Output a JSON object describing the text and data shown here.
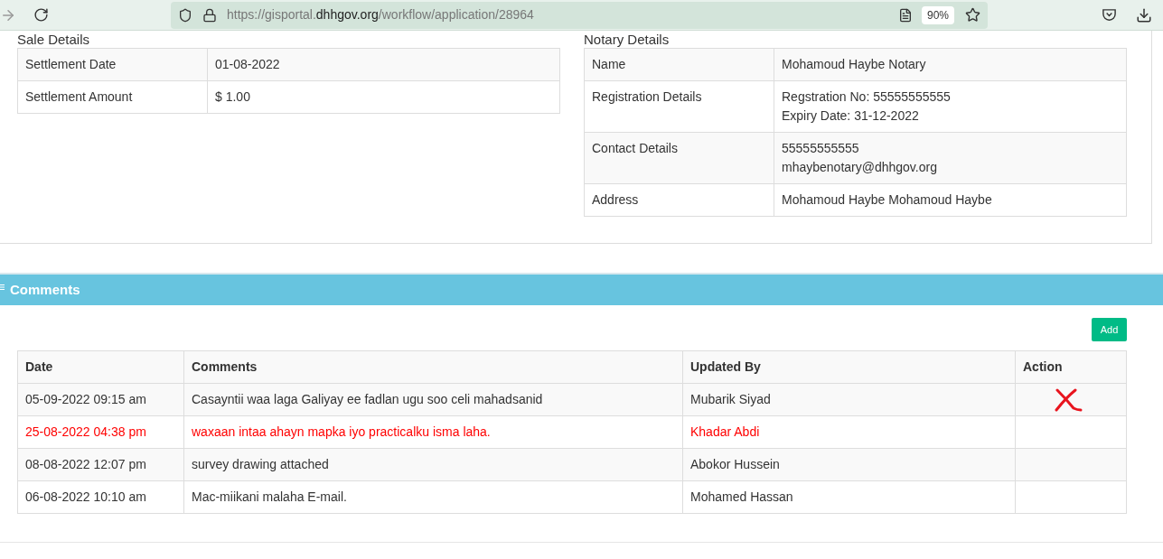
{
  "browser": {
    "url_prefix": "https://gisportal.",
    "url_domain": "dhhgov.org",
    "url_path": "/workflow/application/28964",
    "zoom": "90%"
  },
  "sale_details": {
    "title": "Sale Details",
    "rows": [
      {
        "label": "Settlement Date",
        "value": [
          "01-08-2022"
        ]
      },
      {
        "label": "Settlement Amount",
        "value": [
          "$ 1.00"
        ]
      }
    ]
  },
  "notary_details": {
    "title": "Notary Details",
    "rows": [
      {
        "label": "Name",
        "value": [
          "Mohamoud Haybe Notary"
        ]
      },
      {
        "label": "Registration Details",
        "value": [
          "Regstration No: 55555555555",
          "Expiry Date: 31-12-2022"
        ]
      },
      {
        "label": "Contact Details",
        "value": [
          "55555555555",
          "mhaybenotary@dhhgov.org"
        ]
      },
      {
        "label": "Address",
        "value": [
          "Mohamoud Haybe Mohamoud Haybe"
        ]
      }
    ]
  },
  "comments": {
    "title": "Comments",
    "add_button": "Add",
    "columns": [
      "Date",
      "Comments",
      "Updated By",
      "Action"
    ],
    "rows": [
      {
        "date": "05-09-2022 09:15 am",
        "comment": "Casayntii waa laga Galiyay ee fadlan ugu soo celi mahadsanid",
        "updated_by": "Mubarik Siyad",
        "highlighted": false,
        "marked": true
      },
      {
        "date": "25-08-2022 04:38 pm",
        "comment": "waxaan intaa ahayn mapka iyo practicalku isma laha.",
        "updated_by": "Khadar Abdi",
        "highlighted": true,
        "marked": false
      },
      {
        "date": "08-08-2022 12:07 pm",
        "comment": "survey drawing attached",
        "updated_by": "Abokor Hussein",
        "highlighted": false,
        "marked": false
      },
      {
        "date": "06-08-2022 10:10 am",
        "comment": "Mac-miikani malaha E-mail.",
        "updated_by": "Mohamed Hassan",
        "highlighted": false,
        "marked": false
      }
    ]
  }
}
